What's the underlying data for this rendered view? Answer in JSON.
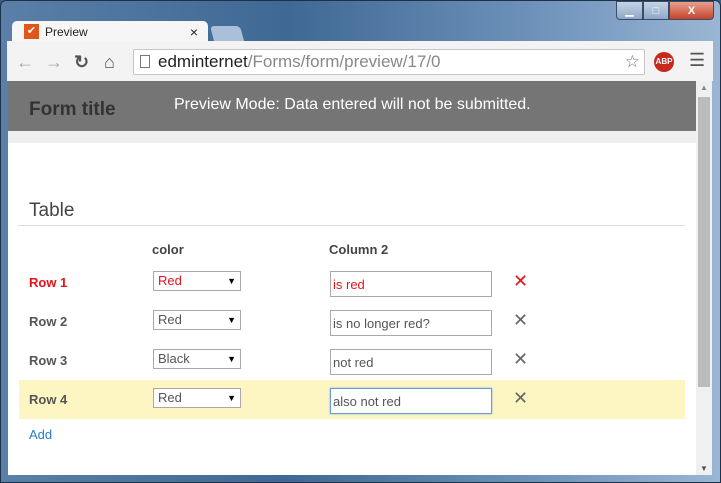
{
  "browser": {
    "tab_title": "Preview",
    "url_host": "edminternet",
    "url_path": "/Forms/form/preview/17/0",
    "close_tab": "×",
    "min": "▁",
    "max": "□",
    "close": "X"
  },
  "header": {
    "title": "Form title",
    "notice": "Preview Mode: Data entered will not be submitted."
  },
  "section": {
    "title": "Table"
  },
  "table": {
    "headers": [
      "color",
      "Column 2"
    ],
    "rows": [
      {
        "label": "Row 1",
        "color": "Red",
        "text": "is red",
        "error": true
      },
      {
        "label": "Row 2",
        "color": "Red",
        "text": "is no longer red?"
      },
      {
        "label": "Row 3",
        "color": "Black",
        "text": "not red"
      },
      {
        "label": "Row 4",
        "color": "Red",
        "text": "also not red",
        "highlighted": true
      }
    ],
    "delete_glyph": "✕"
  },
  "add_label": "Add",
  "colors": {
    "header_bg": "#757575",
    "error": "#e8121a",
    "highlight": "#fdf6c3",
    "link": "#2a7ac9"
  }
}
